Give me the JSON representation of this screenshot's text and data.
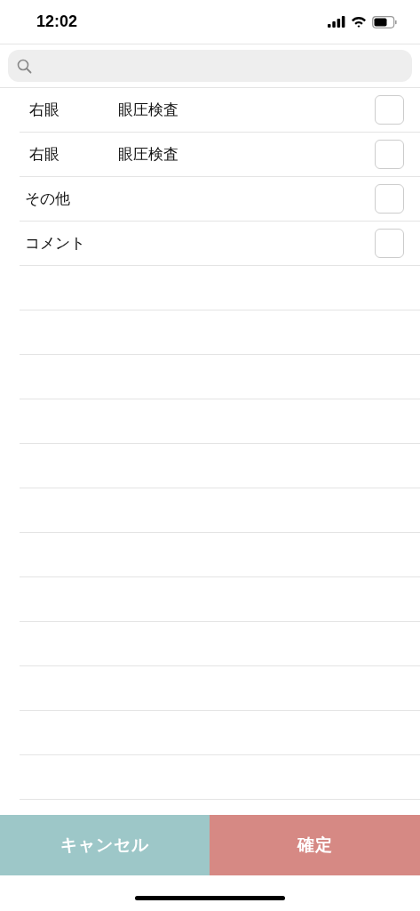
{
  "status_bar": {
    "time": "12:02"
  },
  "items": [
    {
      "kind": "pair",
      "label": "右眼",
      "detail": "眼圧検査",
      "checked": false
    },
    {
      "kind": "pair",
      "label": "右眼",
      "detail": "眼圧検査",
      "checked": false
    },
    {
      "kind": "single",
      "label": "その他",
      "checked": false
    },
    {
      "kind": "single",
      "label": "コメント",
      "checked": false
    }
  ],
  "buttons": [
    {
      "kind": "cancel",
      "label": "キャンセル"
    },
    {
      "kind": "confirm",
      "label": "確定"
    }
  ]
}
